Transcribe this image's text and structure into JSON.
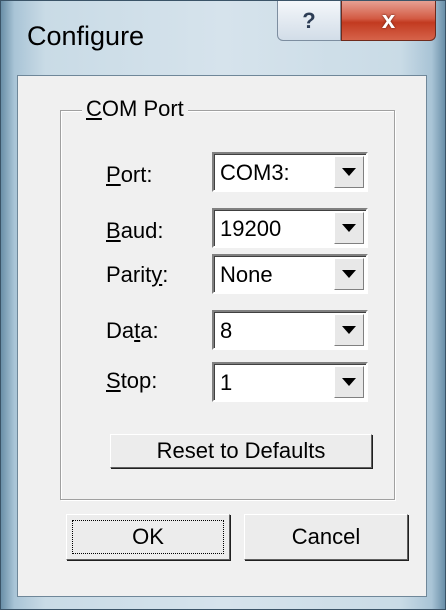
{
  "window": {
    "title": "Configure",
    "help_glyph": "?",
    "close_glyph": "x"
  },
  "group": {
    "legend_mnemonic": "C",
    "legend_rest": "OM Port"
  },
  "fields": [
    {
      "label_pre": "",
      "label_mn": "P",
      "label_post": "ort:",
      "value": "COM3:"
    },
    {
      "label_pre": "",
      "label_mn": "B",
      "label_post": "aud:",
      "value": "19200"
    },
    {
      "label_pre": "Parit",
      "label_mn": "y",
      "label_post": ":",
      "value": "None"
    },
    {
      "label_pre": "Da",
      "label_mn": "t",
      "label_post": "a:",
      "value": "8"
    },
    {
      "label_pre": "",
      "label_mn": "S",
      "label_post": "top:",
      "value": "1"
    }
  ],
  "buttons": {
    "reset": "Reset to Defaults",
    "ok": "OK",
    "cancel": "Cancel"
  }
}
